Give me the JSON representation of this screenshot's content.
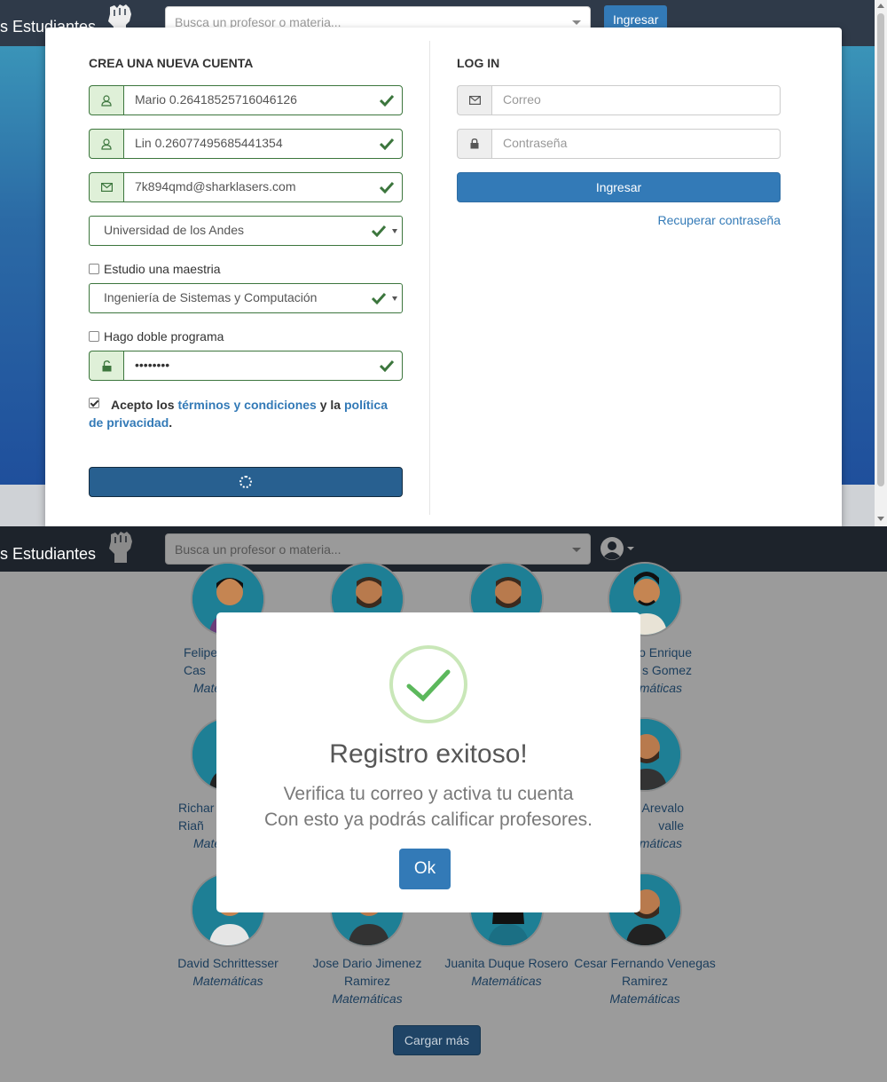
{
  "top": {
    "brand": "s Estudiantes",
    "search_placeholder": "Busca un profesor o materia...",
    "nav_login": "Ingresar",
    "register": {
      "title": "CREA UNA NUEVA CUENTA",
      "first_name": "Mario 0.26418525716046126",
      "last_name": "Lin 0.26077495685441354",
      "email": "7k894qmd@sharklasers.com",
      "university": "Universidad de los Andes",
      "masters_label": "Estudio una maestria",
      "program": "Ingeniería de Sistemas y Computación",
      "double_label": "Hago doble programa",
      "password": "••••••••",
      "terms_prefix": "Acepto los ",
      "terms_link": "términos y condiciones",
      "terms_mid": " y la ",
      "privacy_link": "política de privacidad",
      "terms_suffix": "."
    },
    "login": {
      "title": "LOG IN",
      "email_placeholder": "Correo",
      "password_placeholder": "Contraseña",
      "submit": "Ingresar",
      "recover": "Recuperar contraseña"
    }
  },
  "bottom": {
    "brand": "s Estudiantes",
    "search_placeholder": "Busca un profesor o materia...",
    "professors_row1": [
      {
        "name": "Felipe\nCas",
        "dept": "Mate"
      },
      {
        "name": "",
        "dept": ""
      },
      {
        "name": "",
        "dept": ""
      },
      {
        "name": "o Enrique\ns Gomez",
        "dept": "máticas"
      }
    ],
    "professors_row2": [
      {
        "name": "Richar\nRiañ",
        "dept": "Mate"
      },
      {
        "name": "",
        "dept": ""
      },
      {
        "name": "",
        "dept": ""
      },
      {
        "name": "Arevalo\nvalle",
        "dept": "máticas"
      }
    ],
    "professors_row3": [
      {
        "name": "David Schrittesser",
        "dept": "Matemáticas"
      },
      {
        "name": "Jose Dario Jimenez Ramirez",
        "dept": "Matemáticas"
      },
      {
        "name": "Juanita Duque Rosero",
        "dept": "Matemáticas"
      },
      {
        "name": "Cesar Fernando Venegas Ramirez",
        "dept": "Matemáticas"
      }
    ],
    "load_more": "Cargar más",
    "alert": {
      "title": "Registro exitoso!",
      "line1": "Verifica tu correo y activa tu cuenta",
      "line2": "Con esto ya podrás calificar profesores.",
      "ok": "Ok"
    }
  },
  "colors": {
    "primary": "#337ab7",
    "success": "#3c763d",
    "navbar": "#2f3a49"
  }
}
